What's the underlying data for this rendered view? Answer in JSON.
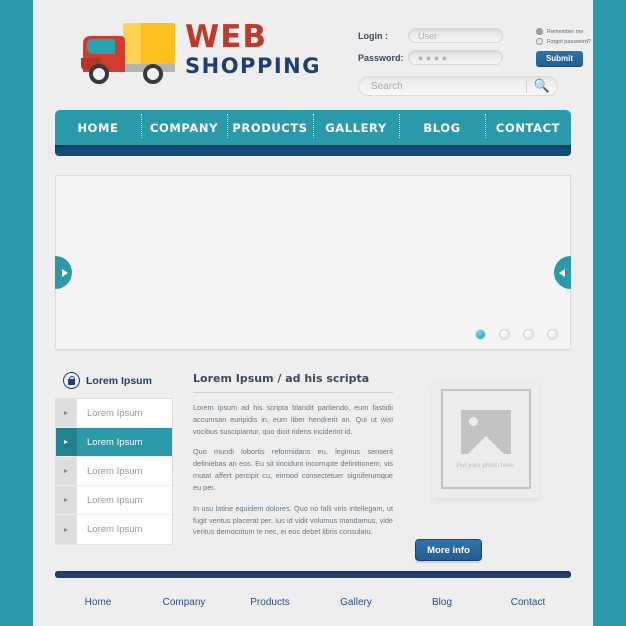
{
  "brand": {
    "logo_icon": "delivery-truck-icon",
    "line1": "WEB",
    "line2": "SHOPPING"
  },
  "login": {
    "login_label": "Login :",
    "login_value": "",
    "login_placeholder": "User",
    "password_label": "Password:",
    "password_value": "",
    "password_placeholder": "● ● ● ●",
    "remember_me": "Remember me",
    "forgot_password": "Forgot password?",
    "submit_label": "Submit"
  },
  "search": {
    "value": "",
    "placeholder": "Search",
    "icon": "search-icon"
  },
  "nav": {
    "items": [
      {
        "label": "HOME"
      },
      {
        "label": "COMPANY"
      },
      {
        "label": "PRODUCTS"
      },
      {
        "label": "GALLERY"
      },
      {
        "label": "BLOG"
      },
      {
        "label": "CONTACT"
      }
    ]
  },
  "slider": {
    "prev_icon": "chevron-right-icon",
    "next_icon": "chevron-left-icon",
    "dots": [
      {
        "active": true
      },
      {
        "active": false
      },
      {
        "active": false
      },
      {
        "active": false
      }
    ]
  },
  "sidebar": {
    "heading": "Lorem Ipsum",
    "heading_icon": "lock-icon",
    "items": [
      {
        "label": "Lorem Ipsum",
        "active": false
      },
      {
        "label": "Lorem Ipsum",
        "active": true
      },
      {
        "label": "Lorem Ipsum",
        "active": false
      },
      {
        "label": "Lorem Ipsum",
        "active": false
      },
      {
        "label": "Lorem Ipsum",
        "active": false
      }
    ]
  },
  "article": {
    "title": "Lorem Ipsum / ad his scripta",
    "p1": "Lorem ipsum ad his scripta blandit partiendo, eum fastidii accumsan euripidis in, eum liber hendrerit an. Qui ut wisi vocibus suscipiantur, quo dicit ridens inciderint id.",
    "p2": "Quo mundi lobortis reformidans eu, legimus senserit definiebas an eos. Eu sit tincidunt incorrupte definitionem, vis mutat affert percipit cu, eirmod consectetuer signiferumque eu per.",
    "p3": "In usu latine equidem dolores. Quo no falli viris intellegam, ut fugit veritus placerat per. Ius id vidit volumus mandamus, vide veritus democritum te nec, ei eos debet libris consulatu."
  },
  "photo": {
    "caption": "Put your photo here.",
    "icon": "image-placeholder-icon"
  },
  "cta": {
    "more_info": "More info"
  },
  "footer": {
    "items": [
      {
        "label": "Home"
      },
      {
        "label": "Company"
      },
      {
        "label": "Products"
      },
      {
        "label": "Gallery"
      },
      {
        "label": "Blog"
      },
      {
        "label": "Contact"
      }
    ]
  },
  "colors": {
    "teal": "#2a9aab",
    "navy": "#1f3f73",
    "blue_button": "#2f72ab",
    "brand_red": "#c0392b",
    "truck_yellow": "#fcbf1e",
    "page_bg": "#eeeeee",
    "search_icon": "#f0932b"
  }
}
